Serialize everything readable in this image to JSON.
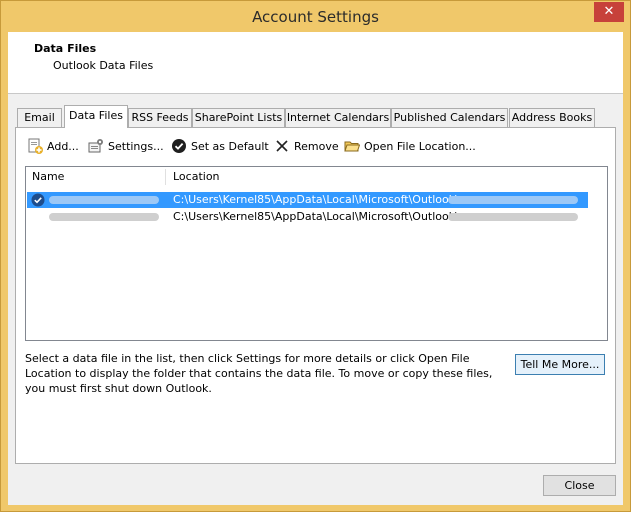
{
  "window": {
    "title": "Account Settings",
    "close_glyph": "✕"
  },
  "header": {
    "title": "Data Files",
    "subtitle": "Outlook Data Files"
  },
  "tabs": [
    {
      "label": "Email"
    },
    {
      "label": "Data Files",
      "active": true
    },
    {
      "label": "RSS Feeds"
    },
    {
      "label": "SharePoint Lists"
    },
    {
      "label": "Internet Calendars"
    },
    {
      "label": "Published Calendars"
    },
    {
      "label": "Address Books"
    }
  ],
  "toolbar": {
    "add": "Add...",
    "settings": "Settings...",
    "set_default": "Set as Default",
    "remove": "Remove",
    "open_location": "Open File Location..."
  },
  "list": {
    "columns": {
      "name": "Name",
      "location": "Location"
    },
    "rows": [
      {
        "location": "C:\\Users\\Kernel85\\AppData\\Local\\Microsoft\\Outlook\\",
        "selected": true,
        "default": true
      },
      {
        "location": "C:\\Users\\Kernel85\\AppData\\Local\\Microsoft\\Outlook\\",
        "selected": false,
        "default": false
      }
    ]
  },
  "help_text": "Select a data file in the list, then click Settings for more details or click Open File Location to display the folder that contains the data file. To move or copy these files, you must first shut down Outlook.",
  "buttons": {
    "tell_me_more": "Tell Me More...",
    "close": "Close"
  },
  "colors": {
    "frame": "#f0c86a",
    "selection": "#3399ff",
    "close_red": "#c7413a"
  }
}
